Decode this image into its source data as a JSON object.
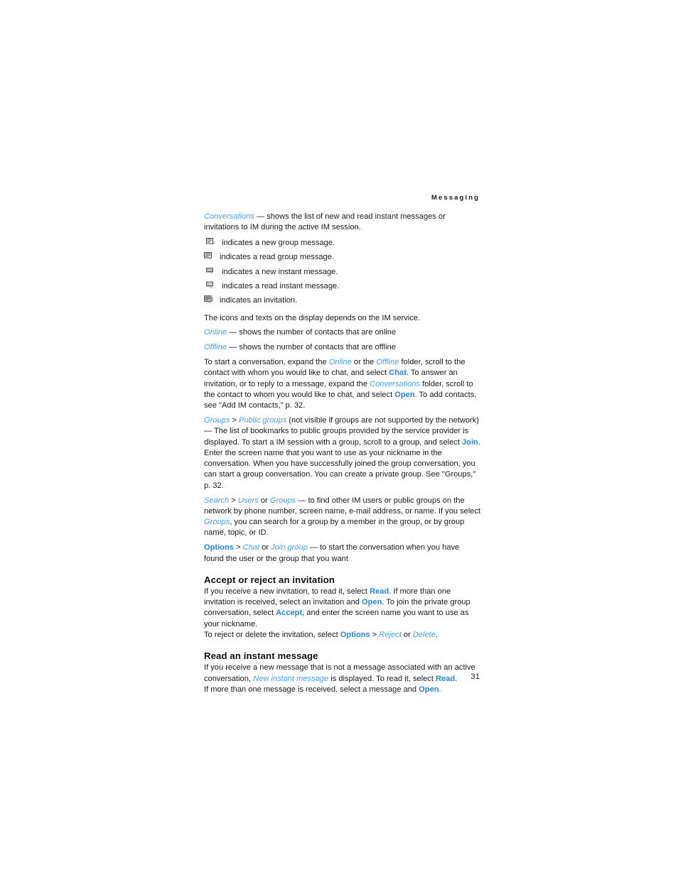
{
  "page": {
    "running_head": "Messaging",
    "page_number": "31"
  },
  "colors": {
    "link_italic": "#4a9fe0",
    "link_bold": "#2a84d2",
    "text": "#1a1a1a",
    "background": "#ffffff"
  },
  "body": {
    "conversations_para": {
      "term": "Conversations",
      "dash": " — ",
      "text": "shows the list of new and read instant messages or invitations to IM during the active IM session."
    },
    "icon_legend": [
      {
        "icon": "new-group-message-icon",
        "label": "indicates a new group message."
      },
      {
        "icon": "read-group-message-icon",
        "label": "indicates a read group message."
      },
      {
        "icon": "new-instant-message-icon",
        "label": "indicates a new instant message."
      },
      {
        "icon": "read-instant-message-icon",
        "label": "indicates a read instant message."
      },
      {
        "icon": "invitation-icon",
        "label": "indicates an invitation."
      }
    ],
    "icons_note": "The icons and texts on the display depends on the IM service.",
    "online_para": {
      "term": "Online",
      "dash": " — ",
      "text": "shows the number of contacts that are online"
    },
    "offline_para": {
      "term": "Offline",
      "dash": " — ",
      "text": "shows the number of contacts that are offline"
    },
    "start_conversation_para": {
      "t1": "To start a conversation, expand the ",
      "online": "Online",
      "t2": " or the ",
      "offline": "Offline",
      "t3": " folder, scroll to the contact with whom you would like to chat, and select ",
      "chat": "Chat",
      "t4": ". To answer an invitation, or to reply to a message, expand the ",
      "conversations": "Conversations",
      "t5": " folder, scroll to the contact to whom you would like to chat, and select ",
      "open": "Open",
      "t6": ". To add contacts, see \"Add IM contacts,\" p. 32."
    },
    "groups_para": {
      "groups": "Groups",
      "gt": " > ",
      "public_groups": "Public groups",
      "t1": " (not visible if groups are not supported by the network) — The list of bookmarks to public groups provided by the service provider is displayed. To start a IM session with a group, scroll to a group, and select ",
      "join": "Join",
      "t2": ". Enter the screen name that you want to use as your nickname in the conversation. When you have successfully joined the group conversation, you can start a group conversation. You can create a private group. See \"Groups,\" p. 32."
    },
    "search_para": {
      "search": "Search",
      "gt": " > ",
      "users": "Users",
      "or": " or ",
      "groups": "Groups",
      "t1": " — to find other IM users or public groups on the network by phone number, screen name, e-mail address, or name. If you select ",
      "groups2": "Groups",
      "t2": ", you can search for a group by a member in the group, or by group name, topic, or ID."
    },
    "options_para": {
      "options": "Options",
      "gt": " > ",
      "chat": "Chat",
      "or": " or ",
      "join_group": "Join group",
      "t1": " — to start the conversation when you have found the user or the group that you want"
    },
    "section_accept": {
      "heading": "Accept or reject an invitation",
      "t1": "If you receive a new invitation, to read it, select ",
      "read": "Read",
      "t2": ". If more than one invitation is received, select an invitation and ",
      "open": "Open",
      "t3": ". To join the private group conversation, select ",
      "accept": "Accept",
      "t4": ", and enter the screen name you want to use as your nickname.",
      "t5": "To reject or delete the invitation, select ",
      "options": "Options",
      "gt": " > ",
      "reject": "Reject",
      "or": " or ",
      "delete": "Delete",
      "t6": "."
    },
    "section_read": {
      "heading": "Read an instant message",
      "t1": "If you receive a new message that is not a message associated with an active conversation, ",
      "new_instant_message": "New instant message",
      "t2": " is displayed. To read it, select ",
      "read": "Read",
      "t3": ".",
      "t4": "If more than one message is received, select a message and ",
      "open": "Open",
      "t5": "."
    }
  }
}
